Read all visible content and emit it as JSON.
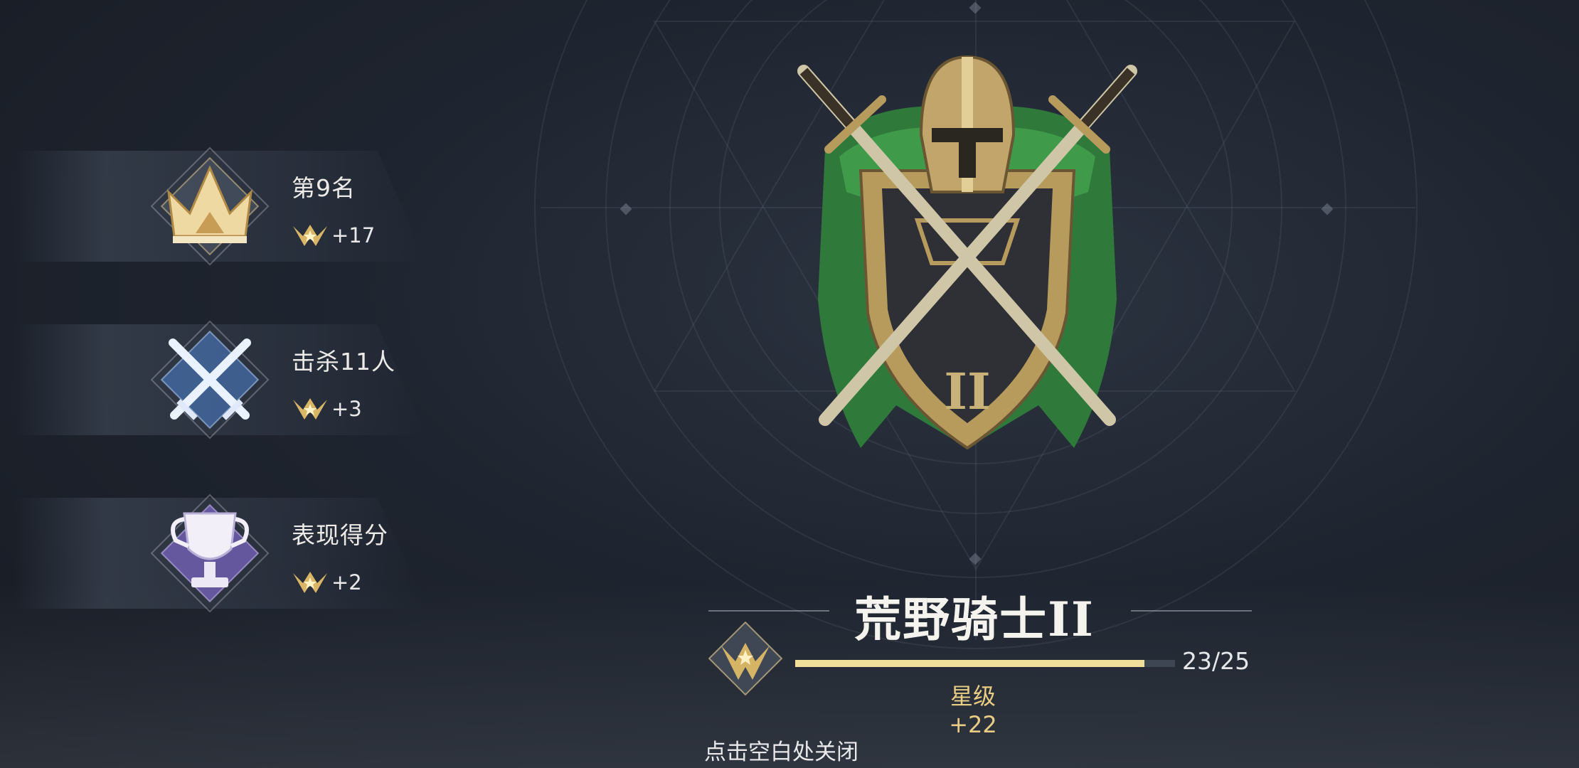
{
  "rewards": [
    {
      "icon": "crown-icon",
      "title": "第9名",
      "bonus": "+17"
    },
    {
      "icon": "crossed-swords-icon",
      "title": "击杀11人",
      "bonus": "+3"
    },
    {
      "icon": "trophy-icon",
      "title": "表现得分",
      "bonus": "+2"
    }
  ],
  "rank": {
    "emblem": "knight-helmet-shield-emblem",
    "title": "荒野骑士II",
    "progress_text": "23/25",
    "progress_fraction": 0.92,
    "star_gain": "星级 +22"
  },
  "close_hint": "点击空白处关闭",
  "colors": {
    "gold": "#e9cd84",
    "progress": "#efdf9b",
    "background": "#1f2530",
    "cape": "#2f7a3a"
  }
}
